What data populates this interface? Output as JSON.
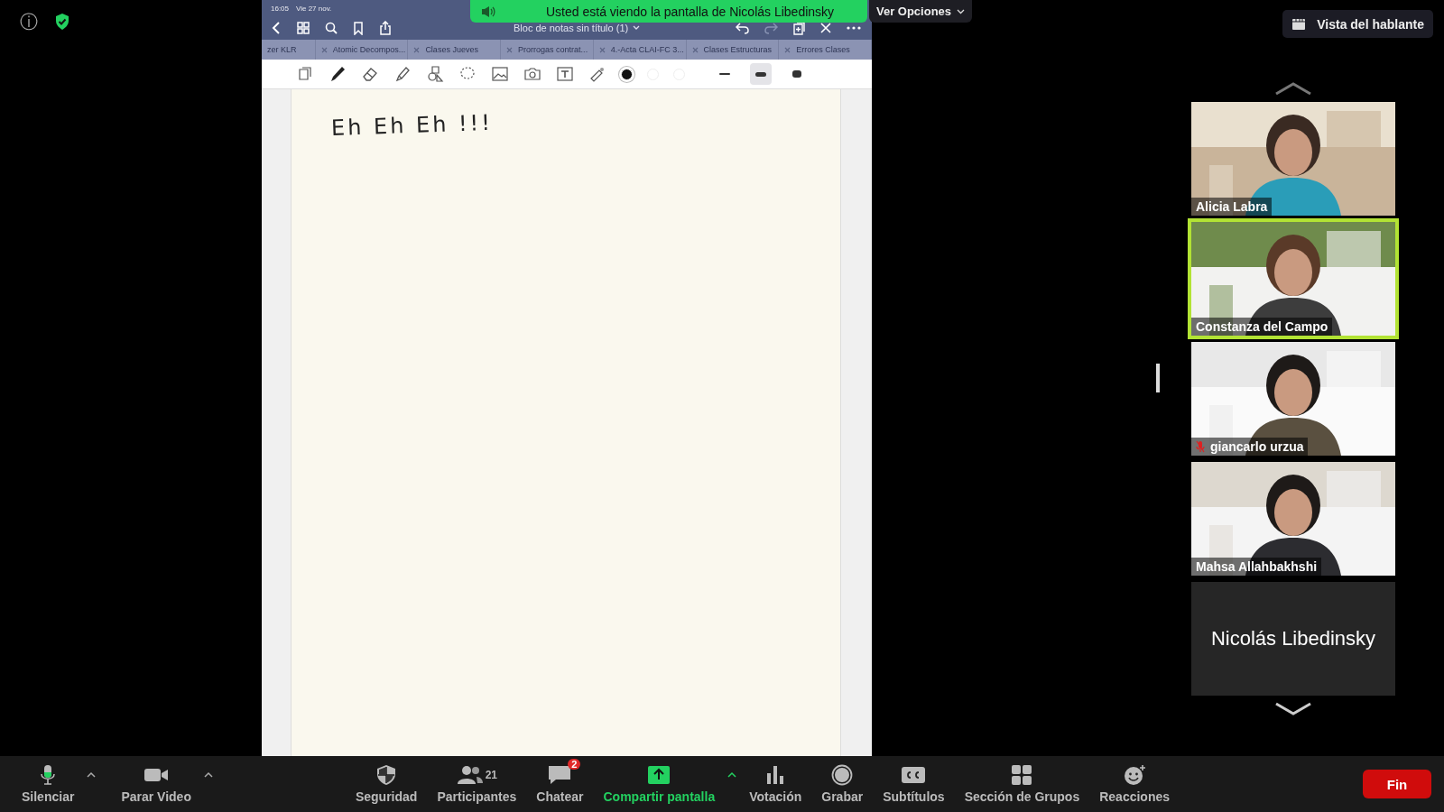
{
  "top_left": {
    "info": "ⓘ"
  },
  "share_banner": {
    "text": "Usted está viendo la pantalla de Nicolás Libedinsky",
    "options_button": "Ver Opciones"
  },
  "view_button": "Vista del hablante",
  "shared_screen": {
    "status_time": "16:05",
    "status_date": "Vie 27 nov.",
    "notebook_title": "Bloc de notas sin título (1)",
    "tabs": [
      {
        "label": "zer KLR",
        "selected": false
      },
      {
        "label": "Atomic Decompos...",
        "selected": false
      },
      {
        "label": "Clases Jueves",
        "selected": false
      },
      {
        "label": "Prorrogas contrat...",
        "selected": false
      },
      {
        "label": "4.-Acta CLAI-FC 3...",
        "selected": false
      },
      {
        "label": "Clases Estructuras",
        "selected": false
      },
      {
        "label": "Errores Clases",
        "selected": false
      }
    ],
    "colors": [
      {
        "color": "#111111",
        "selected": true
      },
      {
        "color": "#ffffff",
        "selected": false
      },
      {
        "color": "#ffffff",
        "selected": false
      }
    ],
    "widths": [
      {
        "selected": false
      },
      {
        "selected": true
      },
      {
        "selected": false
      }
    ],
    "ink_text": "Eh Eh Eh !!!"
  },
  "participants": [
    {
      "name": "Alicia Labra",
      "speaking": false,
      "muted": false,
      "kind": "video"
    },
    {
      "name": "Constanza del Campo",
      "speaking": true,
      "muted": false,
      "kind": "video"
    },
    {
      "name": "giancarlo urzua",
      "speaking": false,
      "muted": true,
      "kind": "video"
    },
    {
      "name": "Mahsa Allahbakhshi",
      "speaking": false,
      "muted": false,
      "kind": "video"
    },
    {
      "name": "Nicolás Libedinsky",
      "speaking": false,
      "muted": false,
      "kind": "name"
    }
  ],
  "toolbar": {
    "left": [
      {
        "label": "Silenciar",
        "kind": "mic"
      },
      {
        "label": "Parar Video",
        "kind": "video"
      }
    ],
    "center": [
      {
        "label": "Seguridad",
        "kind": "shield",
        "active": false
      },
      {
        "label": "Participantes",
        "kind": "people",
        "count": "21",
        "active": false
      },
      {
        "label": "Chatear",
        "kind": "chat",
        "badge": "2",
        "active": false
      },
      {
        "label": "Compartir pantalla",
        "kind": "share",
        "active": true
      },
      {
        "label": "Votación",
        "kind": "poll",
        "active": false
      },
      {
        "label": "Grabar",
        "kind": "record",
        "active": false
      },
      {
        "label": "Subtítulos",
        "kind": "cc",
        "active": false
      },
      {
        "label": "Sección de Grupos",
        "kind": "grid",
        "active": false
      },
      {
        "label": "Reacciones",
        "kind": "smile",
        "active": false
      }
    ],
    "end_button": "Fin"
  }
}
